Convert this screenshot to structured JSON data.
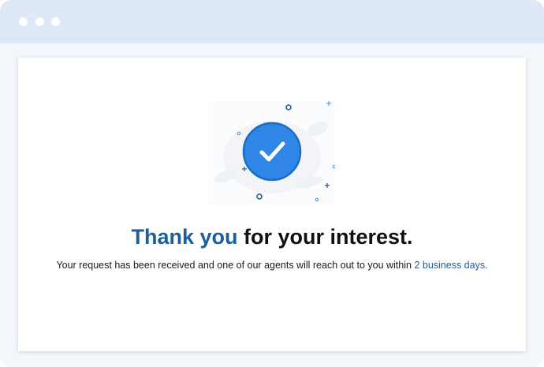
{
  "window": {
    "controls": [
      "dot",
      "dot",
      "dot"
    ]
  },
  "confirmation": {
    "icon": "check-circle-icon",
    "headline_accent": "Thank you",
    "headline_rest": " for your interest.",
    "message_prefix": "Your request has been received and one of our agents will reach out to you within ",
    "message_highlight": "2 business days."
  },
  "colors": {
    "accent": "#1d5e9c",
    "check_circle": "#2f86e6",
    "titlebar": "#dfe8f8"
  }
}
